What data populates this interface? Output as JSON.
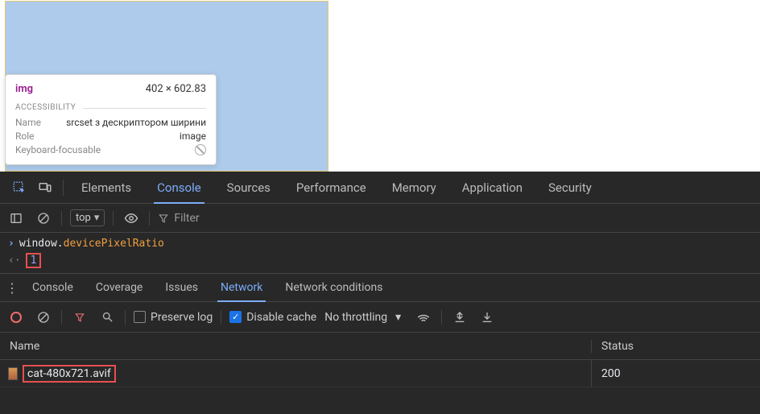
{
  "tooltip": {
    "tag": "img",
    "dimensions": "402 × 602.83",
    "section": "ACCESSIBILITY",
    "name_label": "Name",
    "name_value": "srcset з дескриптором ширини",
    "role_label": "Role",
    "role_value": "image",
    "keyboard_label": "Keyboard-focusable"
  },
  "main_tabs": {
    "elements": "Elements",
    "console": "Console",
    "sources": "Sources",
    "performance": "Performance",
    "memory": "Memory",
    "application": "Application",
    "security": "Security"
  },
  "console_toolbar": {
    "context": "top",
    "filter_placeholder": "Filter"
  },
  "console": {
    "input_obj": "window",
    "input_dot": ".",
    "input_prop": "devicePixelRatio",
    "result": "1"
  },
  "drawer_tabs": {
    "console": "Console",
    "coverage": "Coverage",
    "issues": "Issues",
    "network": "Network",
    "network_conditions": "Network conditions"
  },
  "network_toolbar": {
    "preserve_log": "Preserve log",
    "disable_cache": "Disable cache",
    "throttling": "No throttling"
  },
  "network_table": {
    "col_name": "Name",
    "col_status": "Status",
    "rows": [
      {
        "name": "cat-480x721.avif",
        "status": "200"
      }
    ]
  }
}
